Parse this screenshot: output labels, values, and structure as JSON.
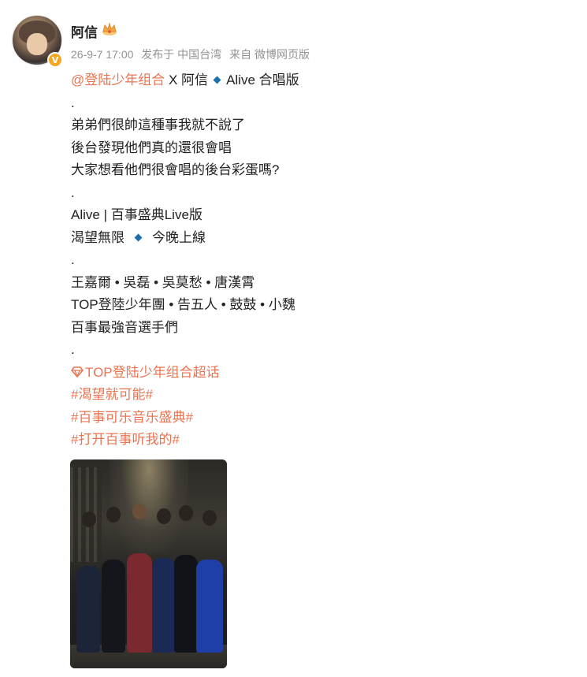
{
  "post": {
    "author": {
      "name": "阿信",
      "verified_badge": "V",
      "badge_icon": "crown-icon"
    },
    "meta": {
      "date": "26-9-7 17:00",
      "location": "发布于 中国台湾",
      "source": "来自 微博网页版"
    },
    "lines": {
      "l1_mention": "@登陆少年组合",
      "l1_text": " X 阿信",
      "l1_after": "Alive 合唱版",
      "l2": ".",
      "l3": "弟弟們很帥這種事我就不說了",
      "l4": "後台發現他們真的還很會唱",
      "l5": "大家想看他們很會唱的後台彩蛋嗎?",
      "l6": ".",
      "l7": "Alive | 百事盛典Live版",
      "l8_a": "渴望無限",
      "l8_b": "今晚上線",
      "l9": ".",
      "l10": "王嘉爾 • 吳磊 • 吳莫愁 • 唐漢霄",
      "l11": "TOP登陸少年團 • 告五人 • 鼓鼓 • 小魏",
      "l12": "百事最強音選手們",
      "l13": "."
    },
    "tags": {
      "supertopic": "TOP登陆少年组合超话",
      "tag1": "#渴望就可能#",
      "tag2": "#百事可乐音乐盛典#",
      "tag3": "#打开百事听我的#"
    },
    "colors": {
      "link": "#eb7350",
      "meta": "#939393",
      "diamond": "#1a6fb0",
      "badge": "#f5a623"
    }
  }
}
